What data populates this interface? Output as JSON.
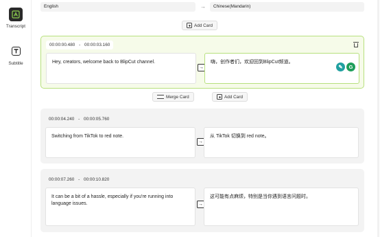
{
  "sidebar": {
    "items": [
      {
        "label": "Transcript",
        "icon": "transcript-icon",
        "active": true
      },
      {
        "label": "Subtitle",
        "icon": "subtitle-icon",
        "active": false
      }
    ]
  },
  "languages": {
    "source": "English",
    "target": "Chinese(Mandarin)",
    "arrow": "→"
  },
  "actions": {
    "add_card": "Add Card",
    "merge_card": "Merge Card"
  },
  "cards": [
    {
      "start": "00:00:00.480",
      "end": "00:00:03.160",
      "source_text": "Hey, creators, welcome back to BlipCut channel.",
      "translated_text": "嗨，创作者们，欢迎回到BlipCut频道。",
      "active": true
    },
    {
      "start": "00:00:04.240",
      "end": "00:00:05.760",
      "source_text": "Switching from TikTok to red note.",
      "translated_text": "从 TikTok 切换到 red note。",
      "active": false
    },
    {
      "start": "00:00:07.260",
      "end": "00:00:10.820",
      "source_text": "It can be a bit of a hassle, especially if you're running into language issues.",
      "translated_text": "这可能有点麻烦，特别是当你遇到语言问题时。",
      "active": false
    }
  ],
  "translate_arrow": "→",
  "timestamp_separator": "-",
  "colors": {
    "accent_green": "#b7e07d",
    "active_bg": "#f6fbe9",
    "card_bg": "#f3f3f3",
    "sidebar_active": "#2a2a2a"
  }
}
